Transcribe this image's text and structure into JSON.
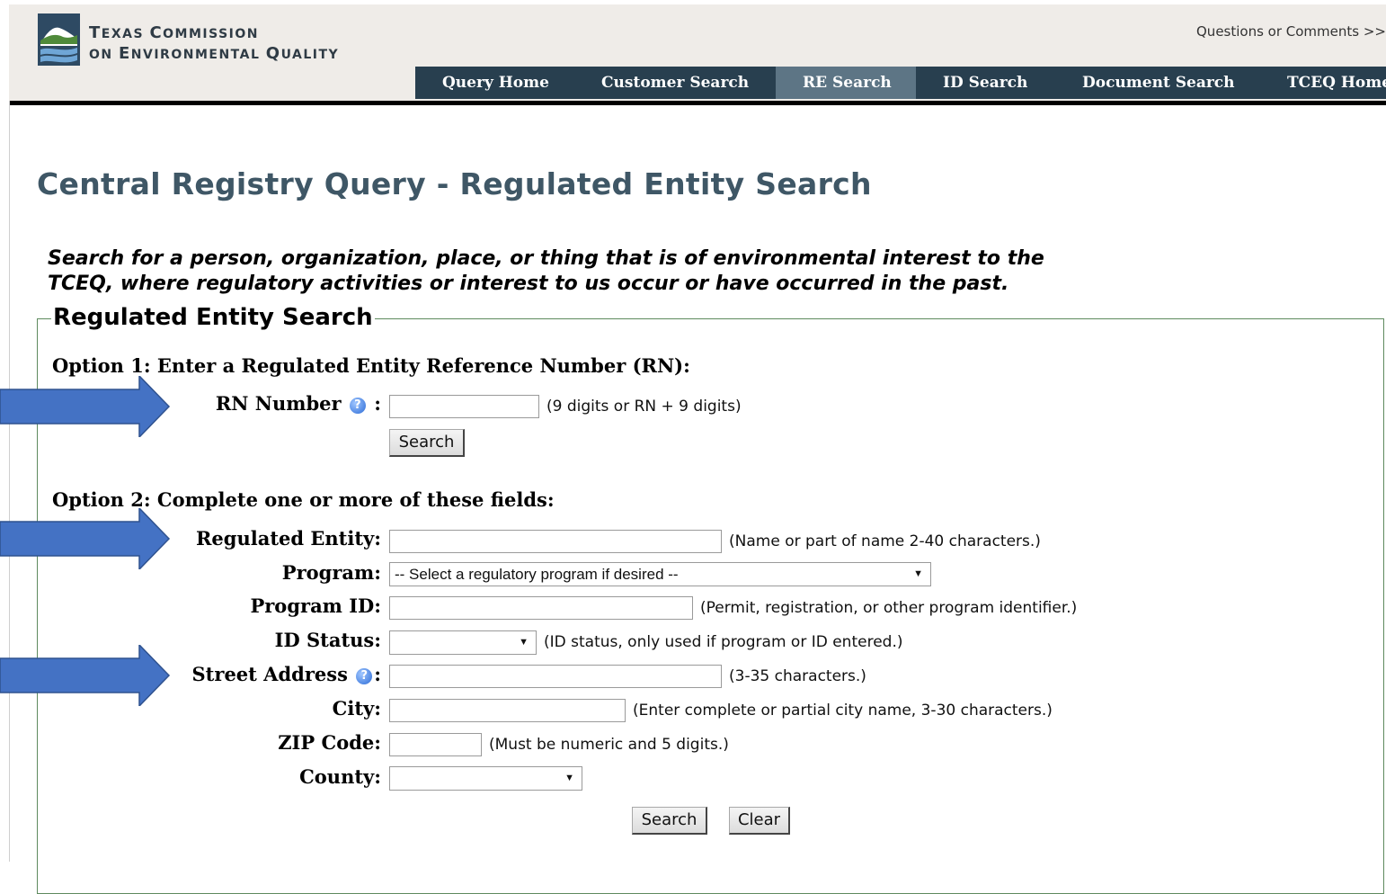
{
  "header": {
    "logo_line1_big": "T",
    "logo_line1_rest": "EXAS ",
    "logo_line1_c": "C",
    "logo_line1_rest2": "OMMISSION",
    "logo_line2_pre": "ON ",
    "logo_line2_e": "E",
    "logo_line2_rest": "NVIRONMENTAL ",
    "logo_line2_q": "Q",
    "logo_line2_rest2": "UALITY",
    "comments_link": "Questions or Comments >>"
  },
  "nav": {
    "items": [
      "Query Home",
      "Customer Search",
      "RE Search",
      "ID Search",
      "Document Search",
      "TCEQ Home"
    ],
    "active_index": 2
  },
  "page": {
    "title": "Central Registry Query - Regulated Entity Search",
    "intro": "Search for a person, organization, place, or thing that is of environmental interest to the TCEQ, where regulatory activities or interest to us occur or have occurred in the past."
  },
  "form": {
    "legend": "Regulated Entity Search",
    "option1": {
      "label": "Option 1: Enter a Regulated Entity Reference Number (RN):",
      "rn_label": "RN Number",
      "rn_colon": ":",
      "rn_value": "",
      "rn_hint": "(9 digits or RN + 9 digits)",
      "search_button": "Search"
    },
    "option2": {
      "label": "Option 2: Complete one or more of these fields:",
      "regulated_entity_label": "Regulated Entity:",
      "regulated_entity_value": "",
      "regulated_entity_hint": "(Name or part of name 2-40 characters.)",
      "program_label": "Program:",
      "program_selected": "-- Select a regulatory program if desired --",
      "program_id_label": "Program ID:",
      "program_id_value": "",
      "program_id_hint": "(Permit, registration, or other program identifier.)",
      "id_status_label": "ID Status:",
      "id_status_selected": "",
      "id_status_hint": "(ID status, only used if program or ID entered.)",
      "street_label": "Street Address",
      "street_colon": ":",
      "street_value": "",
      "street_hint": "(3-35 characters.)",
      "city_label": "City:",
      "city_value": "",
      "city_hint": "(Enter complete or partial city name, 3-30 characters.)",
      "zip_label": "ZIP Code:",
      "zip_value": "",
      "zip_hint": "(Must be numeric and 5 digits.)",
      "county_label": "County:",
      "county_selected": "",
      "search_button": "Search",
      "clear_button": "Clear"
    }
  },
  "colors": {
    "nav_bg": "#283f4f",
    "nav_active": "#5d7585",
    "title": "#3f5766",
    "arrow": "#4472c4",
    "fieldset_border": "#5e8a5e"
  }
}
